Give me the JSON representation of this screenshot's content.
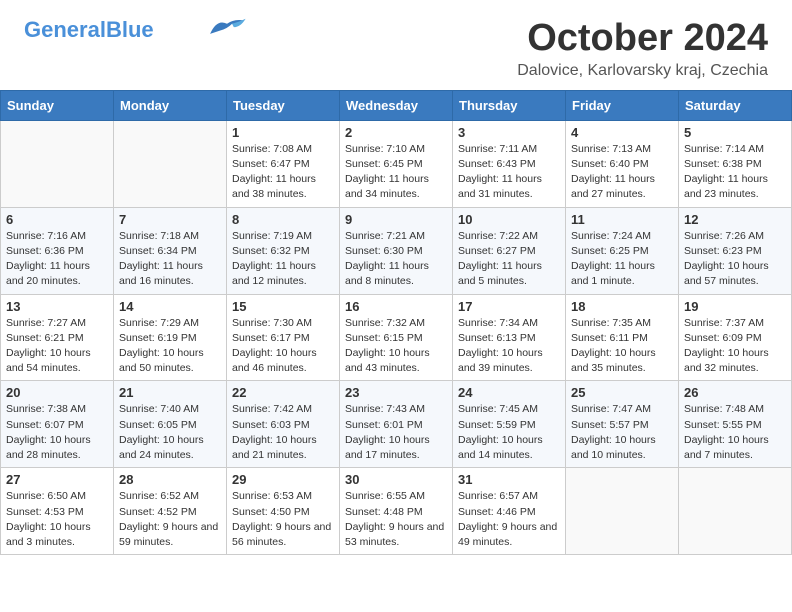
{
  "header": {
    "logo_line1": "General",
    "logo_line2": "Blue",
    "month": "October 2024",
    "location": "Dalovice, Karlovarsky kraj, Czechia"
  },
  "days_of_week": [
    "Sunday",
    "Monday",
    "Tuesday",
    "Wednesday",
    "Thursday",
    "Friday",
    "Saturday"
  ],
  "weeks": [
    [
      {
        "day": "",
        "info": ""
      },
      {
        "day": "",
        "info": ""
      },
      {
        "day": "1",
        "info": "Sunrise: 7:08 AM\nSunset: 6:47 PM\nDaylight: 11 hours and 38 minutes."
      },
      {
        "day": "2",
        "info": "Sunrise: 7:10 AM\nSunset: 6:45 PM\nDaylight: 11 hours and 34 minutes."
      },
      {
        "day": "3",
        "info": "Sunrise: 7:11 AM\nSunset: 6:43 PM\nDaylight: 11 hours and 31 minutes."
      },
      {
        "day": "4",
        "info": "Sunrise: 7:13 AM\nSunset: 6:40 PM\nDaylight: 11 hours and 27 minutes."
      },
      {
        "day": "5",
        "info": "Sunrise: 7:14 AM\nSunset: 6:38 PM\nDaylight: 11 hours and 23 minutes."
      }
    ],
    [
      {
        "day": "6",
        "info": "Sunrise: 7:16 AM\nSunset: 6:36 PM\nDaylight: 11 hours and 20 minutes."
      },
      {
        "day": "7",
        "info": "Sunrise: 7:18 AM\nSunset: 6:34 PM\nDaylight: 11 hours and 16 minutes."
      },
      {
        "day": "8",
        "info": "Sunrise: 7:19 AM\nSunset: 6:32 PM\nDaylight: 11 hours and 12 minutes."
      },
      {
        "day": "9",
        "info": "Sunrise: 7:21 AM\nSunset: 6:30 PM\nDaylight: 11 hours and 8 minutes."
      },
      {
        "day": "10",
        "info": "Sunrise: 7:22 AM\nSunset: 6:27 PM\nDaylight: 11 hours and 5 minutes."
      },
      {
        "day": "11",
        "info": "Sunrise: 7:24 AM\nSunset: 6:25 PM\nDaylight: 11 hours and 1 minute."
      },
      {
        "day": "12",
        "info": "Sunrise: 7:26 AM\nSunset: 6:23 PM\nDaylight: 10 hours and 57 minutes."
      }
    ],
    [
      {
        "day": "13",
        "info": "Sunrise: 7:27 AM\nSunset: 6:21 PM\nDaylight: 10 hours and 54 minutes."
      },
      {
        "day": "14",
        "info": "Sunrise: 7:29 AM\nSunset: 6:19 PM\nDaylight: 10 hours and 50 minutes."
      },
      {
        "day": "15",
        "info": "Sunrise: 7:30 AM\nSunset: 6:17 PM\nDaylight: 10 hours and 46 minutes."
      },
      {
        "day": "16",
        "info": "Sunrise: 7:32 AM\nSunset: 6:15 PM\nDaylight: 10 hours and 43 minutes."
      },
      {
        "day": "17",
        "info": "Sunrise: 7:34 AM\nSunset: 6:13 PM\nDaylight: 10 hours and 39 minutes."
      },
      {
        "day": "18",
        "info": "Sunrise: 7:35 AM\nSunset: 6:11 PM\nDaylight: 10 hours and 35 minutes."
      },
      {
        "day": "19",
        "info": "Sunrise: 7:37 AM\nSunset: 6:09 PM\nDaylight: 10 hours and 32 minutes."
      }
    ],
    [
      {
        "day": "20",
        "info": "Sunrise: 7:38 AM\nSunset: 6:07 PM\nDaylight: 10 hours and 28 minutes."
      },
      {
        "day": "21",
        "info": "Sunrise: 7:40 AM\nSunset: 6:05 PM\nDaylight: 10 hours and 24 minutes."
      },
      {
        "day": "22",
        "info": "Sunrise: 7:42 AM\nSunset: 6:03 PM\nDaylight: 10 hours and 21 minutes."
      },
      {
        "day": "23",
        "info": "Sunrise: 7:43 AM\nSunset: 6:01 PM\nDaylight: 10 hours and 17 minutes."
      },
      {
        "day": "24",
        "info": "Sunrise: 7:45 AM\nSunset: 5:59 PM\nDaylight: 10 hours and 14 minutes."
      },
      {
        "day": "25",
        "info": "Sunrise: 7:47 AM\nSunset: 5:57 PM\nDaylight: 10 hours and 10 minutes."
      },
      {
        "day": "26",
        "info": "Sunrise: 7:48 AM\nSunset: 5:55 PM\nDaylight: 10 hours and 7 minutes."
      }
    ],
    [
      {
        "day": "27",
        "info": "Sunrise: 6:50 AM\nSunset: 4:53 PM\nDaylight: 10 hours and 3 minutes."
      },
      {
        "day": "28",
        "info": "Sunrise: 6:52 AM\nSunset: 4:52 PM\nDaylight: 9 hours and 59 minutes."
      },
      {
        "day": "29",
        "info": "Sunrise: 6:53 AM\nSunset: 4:50 PM\nDaylight: 9 hours and 56 minutes."
      },
      {
        "day": "30",
        "info": "Sunrise: 6:55 AM\nSunset: 4:48 PM\nDaylight: 9 hours and 53 minutes."
      },
      {
        "day": "31",
        "info": "Sunrise: 6:57 AM\nSunset: 4:46 PM\nDaylight: 9 hours and 49 minutes."
      },
      {
        "day": "",
        "info": ""
      },
      {
        "day": "",
        "info": ""
      }
    ]
  ]
}
